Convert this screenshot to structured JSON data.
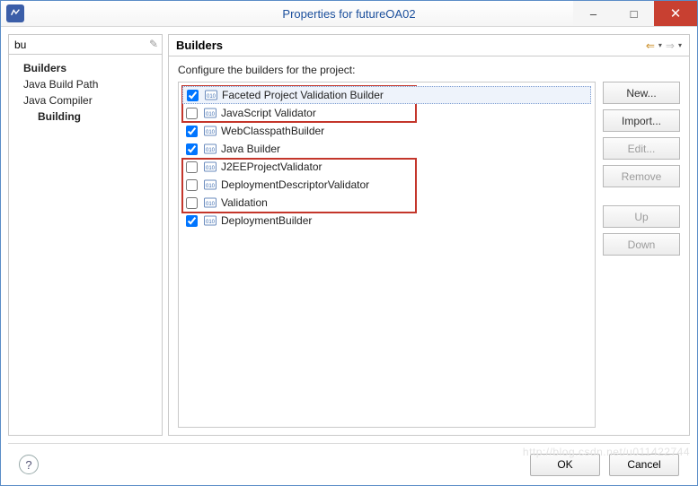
{
  "window": {
    "title": "Properties for futureOA02",
    "minimize": "–",
    "maximize": "□",
    "close": "✕"
  },
  "filter": {
    "value": "bu",
    "clear_glyph": "✎"
  },
  "tree": {
    "builders": "Builders",
    "java_build_path": "Java Build Path",
    "java_compiler": "Java Compiler",
    "building": "Building"
  },
  "panel": {
    "title": "Builders",
    "desc": "Configure the builders for the project:",
    "nav_back": "⇐",
    "nav_fwd": "⇒"
  },
  "builders": [
    {
      "label": "Faceted Project Validation Builder",
      "checked": true
    },
    {
      "label": "JavaScript Validator",
      "checked": false
    },
    {
      "label": "WebClasspathBuilder",
      "checked": true
    },
    {
      "label": "Java Builder",
      "checked": true
    },
    {
      "label": "J2EEProjectValidator",
      "checked": false
    },
    {
      "label": "DeploymentDescriptorValidator",
      "checked": false
    },
    {
      "label": "Validation",
      "checked": false
    },
    {
      "label": "DeploymentBuilder",
      "checked": true
    }
  ],
  "buttons": {
    "new": "New...",
    "import": "Import...",
    "edit": "Edit...",
    "remove": "Remove",
    "up": "Up",
    "down": "Down"
  },
  "footer": {
    "help": "?",
    "ok": "OK",
    "cancel": "Cancel"
  },
  "watermark": "http://blog.csdn.net/u011422744"
}
